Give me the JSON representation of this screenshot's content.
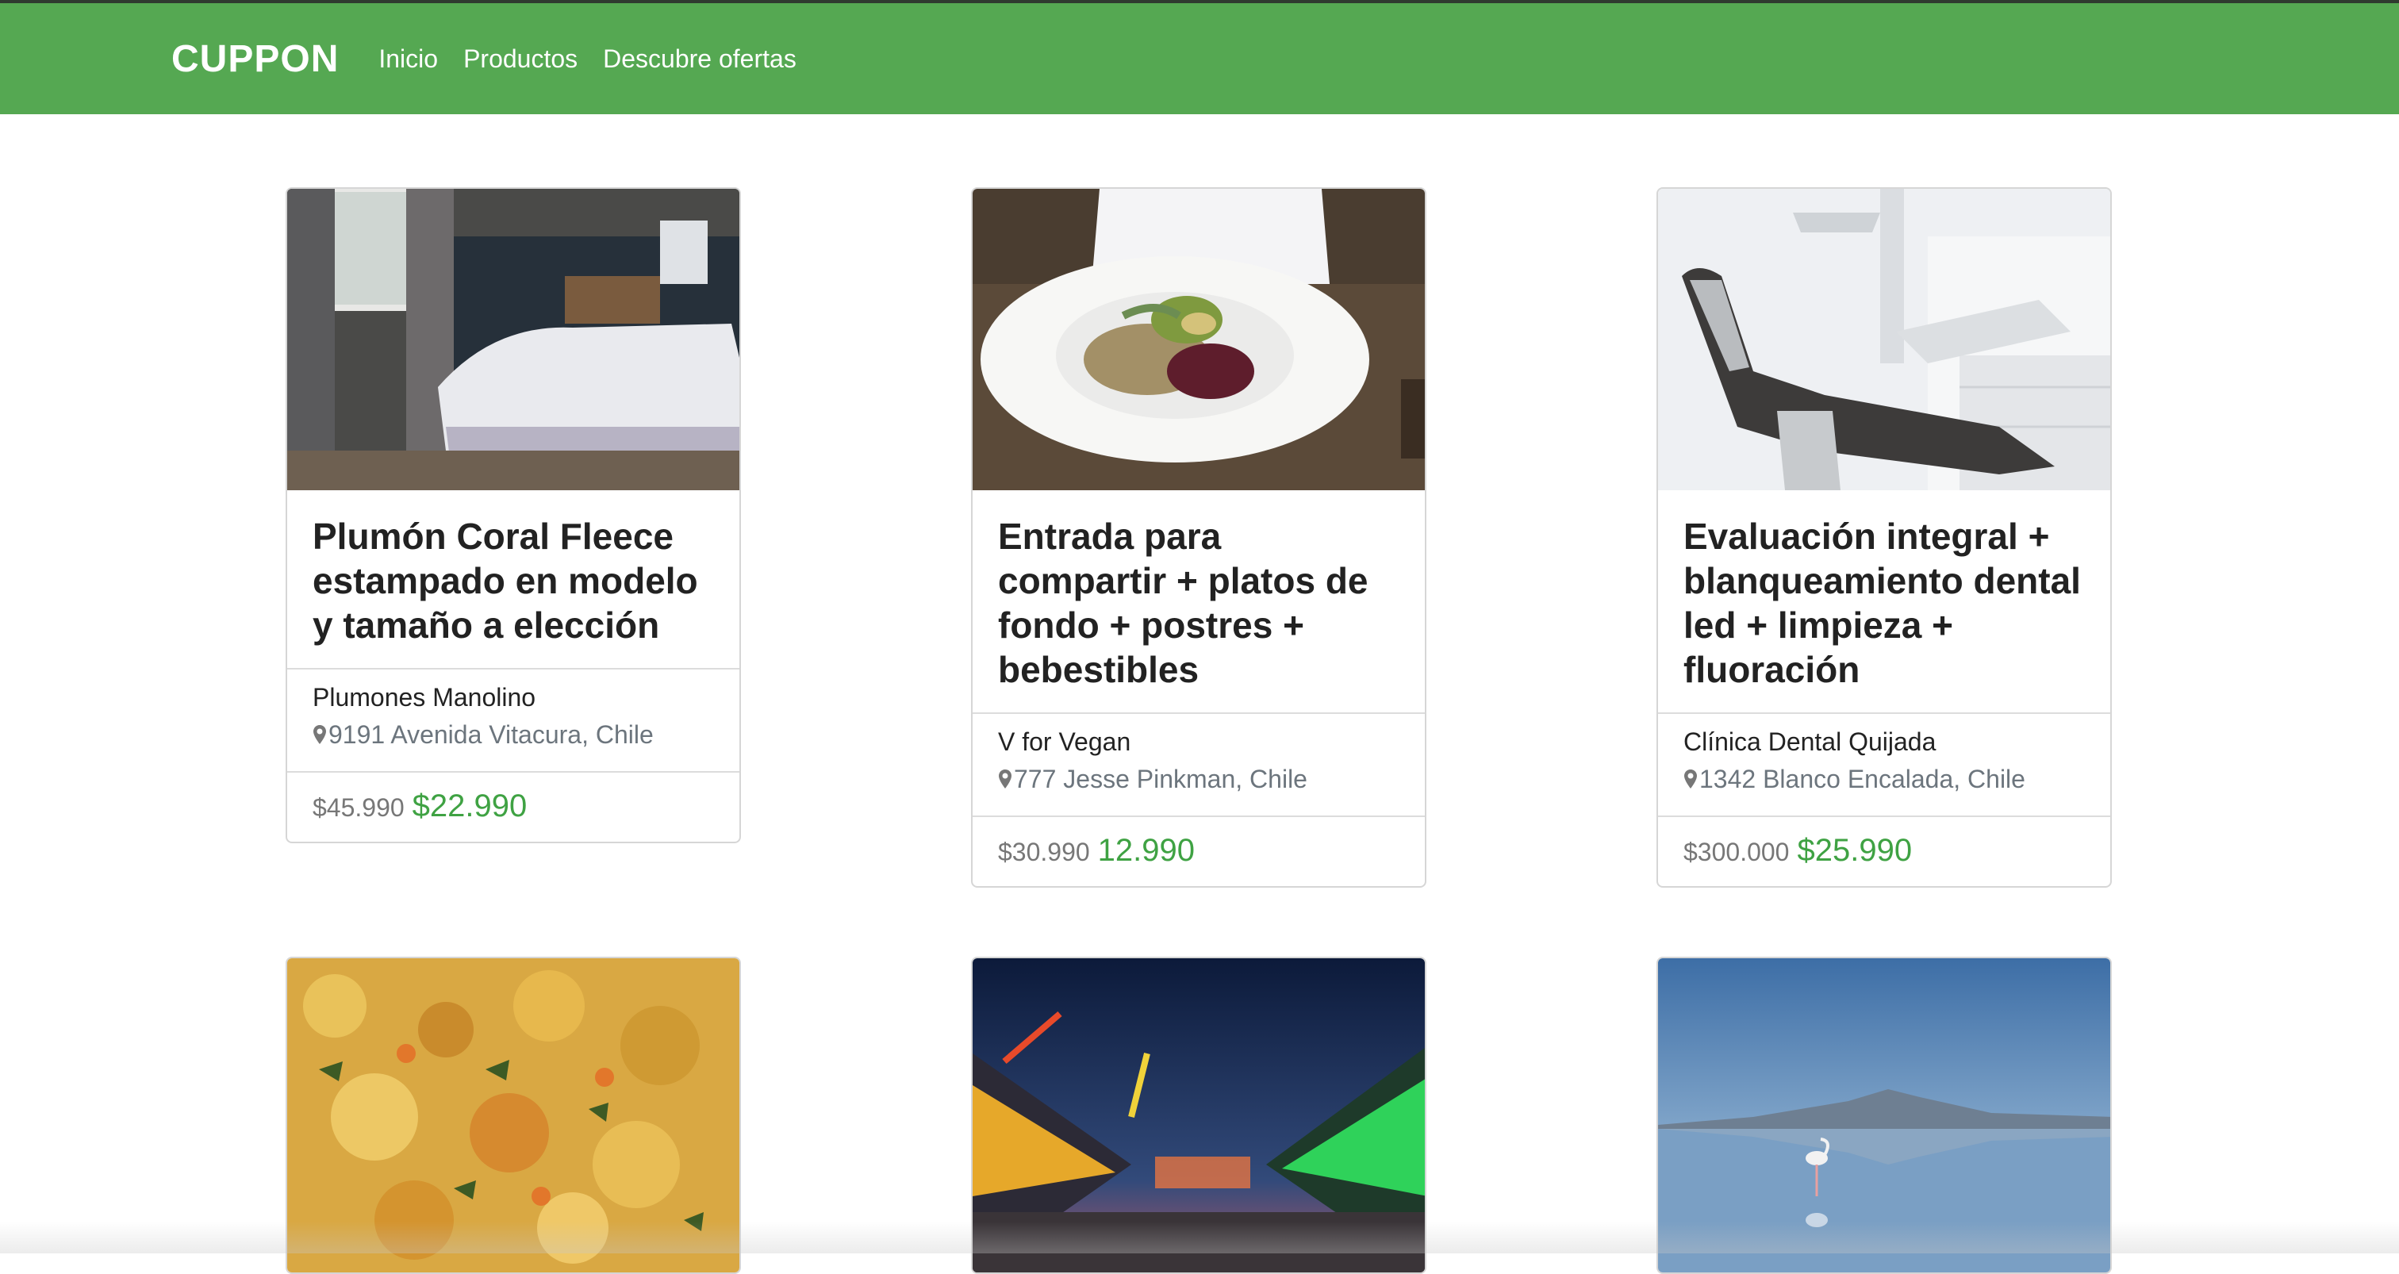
{
  "nav": {
    "brand": "CUPPON",
    "links": [
      "Inicio",
      "Productos",
      "Descubre ofertas"
    ]
  },
  "colors": {
    "navbar": "#55a852",
    "price_accent": "#3fa243"
  },
  "cards": [
    {
      "title": "Plumón Coral Fleece estampado en modelo y tamaño a elección",
      "merchant": "Plumones Manolino",
      "address": "9191 Avenida Vitacura, Chile",
      "old_price": "$45.990",
      "new_price": "$22.990",
      "image": "bedroom-photo"
    },
    {
      "title": "Entrada para compartir + platos de fondo + postres + bebestibles",
      "merchant": "V for Vegan",
      "address": "777 Jesse Pinkman, Chile",
      "old_price": "$30.990",
      "new_price": "12.990",
      "image": "vegan-dish-photo"
    },
    {
      "title": "Evaluación integral + blanqueamiento dental led + limpieza + fluoración",
      "merchant": "Clínica Dental Quijada",
      "address": "1342 Blanco Encalada, Chile",
      "old_price": "$300.000",
      "new_price": "$25.990",
      "image": "dental-chair-photo"
    },
    {
      "image": "curry-food-photo"
    },
    {
      "image": "fairground-night-photo"
    },
    {
      "image": "lake-flamingo-photo"
    }
  ]
}
